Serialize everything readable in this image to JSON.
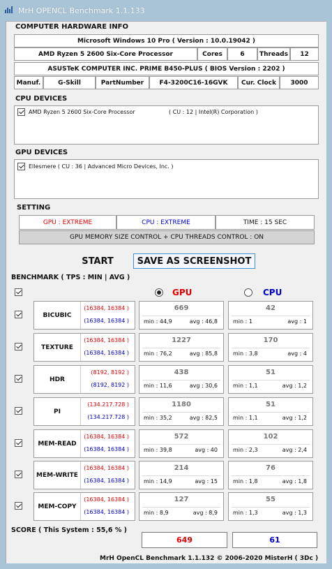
{
  "window": {
    "title": "MrH OPENCL Benchmark 1.1.133"
  },
  "hardware": {
    "section": "COMPUTER HARDWARE INFO",
    "os": "Microsoft Windows 10 Pro ( Version : 10.0.19042 )",
    "cpu": "AMD Ryzen 5 2600 Six-Core Processor",
    "cores_label": "Cores",
    "cores": "6",
    "threads_label": "Threads",
    "threads": "12",
    "board": "ASUSTeK COMPUTER INC. PRIME B450-PLUS ( BIOS Version : 2202 )",
    "manuf_label": "Manuf.",
    "manuf": "G-Skill",
    "part_label": "PartNumber",
    "part": "F4-3200C16-16GVK",
    "clock_label": "Cur. Clock",
    "clock": "3000"
  },
  "cpu_devices": {
    "section": "CPU DEVICES",
    "item_name": "AMD Ryzen 5 2600 Six-Core Processor",
    "item_info": "( CU : 12 | Intel(R) Corporation )"
  },
  "gpu_devices": {
    "section": "GPU DEVICES",
    "item": "Ellesmere ( CU : 36 | Advanced Micro Devices, Inc. )"
  },
  "setting": {
    "section": "SETTING",
    "gpu": "GPU : EXTREME",
    "cpu": "CPU : EXTREME",
    "time": "TIME : 15 SEC",
    "control": "GPU MEMORY SIZE CONTROL + CPU THREADS CONTROL : ON"
  },
  "buttons": {
    "start": "START",
    "save": "SAVE AS SCREENSHOT"
  },
  "benchmark": {
    "section": "BENCHMARK ( TPS : MIN | AVG )",
    "gpu_label": "GPU",
    "cpu_label": "CPU",
    "rows": [
      {
        "name": "BICUBIC",
        "gsize": "(16384, 16384 )",
        "csize": "(16384, 16384 )",
        "gpu": "669",
        "gpu_min": "min : 44,9",
        "gpu_avg": "avg : 46,8",
        "cpu": "42",
        "cpu_min": "min : 1",
        "cpu_avg": "avg : 1"
      },
      {
        "name": "TEXTURE",
        "gsize": "(16384, 16384 )",
        "csize": "(16384, 16384 )",
        "gpu": "1227",
        "gpu_min": "min : 76,2",
        "gpu_avg": "avg : 85,8",
        "cpu": "170",
        "cpu_min": "min : 3,8",
        "cpu_avg": "avg : 4"
      },
      {
        "name": "HDR",
        "gsize": "(8192, 8192 )",
        "csize": "(8192, 8192 )",
        "gpu": "438",
        "gpu_min": "min : 11,6",
        "gpu_avg": "avg : 30,6",
        "cpu": "51",
        "cpu_min": "min : 1,1",
        "cpu_avg": "avg : 1,2"
      },
      {
        "name": "PI",
        "gsize": "(134.217.728 )",
        "csize": "(134.217.728 )",
        "gpu": "1180",
        "gpu_min": "min : 35,2",
        "gpu_avg": "avg : 82,5",
        "cpu": "51",
        "cpu_min": "min : 1,1",
        "cpu_avg": "avg : 1,2"
      },
      {
        "name": "MEM-READ",
        "gsize": "(16384, 16384 )",
        "csize": "(16384, 16384 )",
        "gpu": "572",
        "gpu_min": "min : 39,8",
        "gpu_avg": "avg : 40",
        "cpu": "102",
        "cpu_min": "min : 2,3",
        "cpu_avg": "avg : 2,4"
      },
      {
        "name": "MEM-WRITE",
        "gsize": "(16384, 16384 )",
        "csize": "(16384, 16384 )",
        "gpu": "214",
        "gpu_min": "min : 14,9",
        "gpu_avg": "avg : 15",
        "cpu": "76",
        "cpu_min": "min : 1,8",
        "cpu_avg": "avg : 1,8"
      },
      {
        "name": "MEM-COPY",
        "gsize": "(16384, 16384 )",
        "csize": "(16384, 16384 )",
        "gpu": "127",
        "gpu_min": "min : 8,9",
        "gpu_avg": "avg : 8,9",
        "cpu": "55",
        "cpu_min": "min : 1,3",
        "cpu_avg": "avg : 1,3"
      }
    ]
  },
  "score": {
    "label": "SCORE ( This System : 55,6 % )",
    "gpu": "649",
    "cpu": "61"
  },
  "footer": "MrH OpenCL Benchmark 1.1.132  ©  2006-2020 MisterH ( 3Dc )",
  "colors": {
    "gpu": "#e00000",
    "cpu": "#0000cc",
    "title_bar": "#a9c4d6"
  }
}
